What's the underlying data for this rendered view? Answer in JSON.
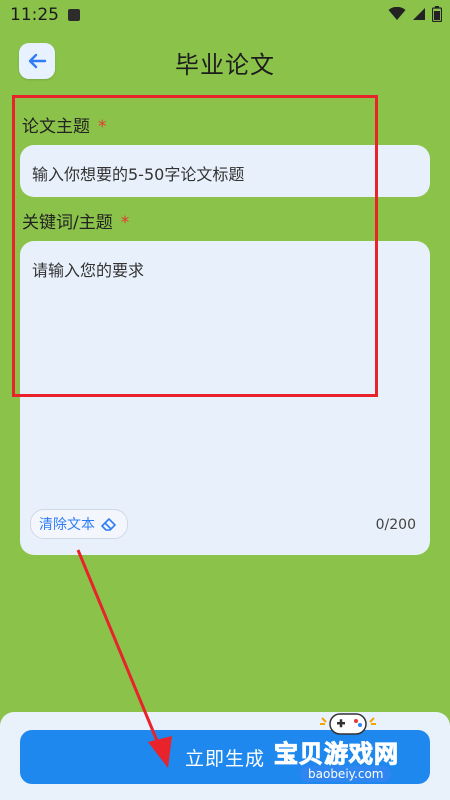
{
  "status_bar": {
    "time": "11:25"
  },
  "header": {
    "title": "毕业论文",
    "back_icon": "arrow-left-icon"
  },
  "form": {
    "topic": {
      "label": "论文主题",
      "required_mark": "*",
      "placeholder": "输入你想要的5-50字论文标题"
    },
    "keywords": {
      "label": "关键词/主题",
      "required_mark": "*",
      "placeholder": "请输入您的要求",
      "clear_label": "清除文本",
      "counter": "0/200"
    }
  },
  "bottom": {
    "generate_label": "立即生成"
  },
  "watermark": {
    "title": "宝贝游戏网",
    "url": "baobeiy.com"
  },
  "colors": {
    "background": "#8bc34a",
    "accent": "#1e88ee",
    "input_bg": "#e8f1fb",
    "annotation": "#e8232b"
  }
}
